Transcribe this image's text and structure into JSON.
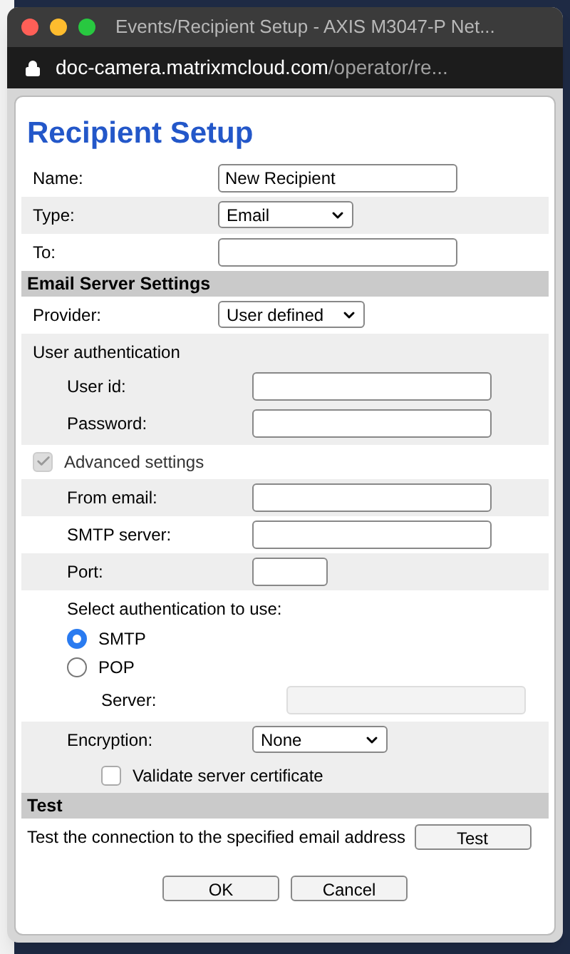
{
  "window": {
    "title": "Events/Recipient Setup - AXIS M3047-P Net..."
  },
  "address_bar": {
    "host": "doc-camera.matrixmcloud.com",
    "path": "/operator/re..."
  },
  "heading": "Recipient Setup",
  "sections": [
    {
      "rows": [
        {
          "kind": "field",
          "label": "Name:",
          "value": "New Recipient"
        },
        {
          "kind": "select",
          "label": "Type:",
          "value": "Email"
        },
        {
          "kind": "field",
          "label": "To:"
        }
      ]
    },
    {
      "title": "Email Server Settings",
      "rows": [
        {
          "kind": "select",
          "label": "Provider:",
          "value": "User defined"
        },
        {
          "kind": "group",
          "label": "User authentication",
          "children": [
            {
              "kind": "field",
              "label": "User id:"
            },
            {
              "kind": "field",
              "label": "Password:"
            }
          ]
        },
        {
          "kind": "subsection",
          "label": "Advanced settings",
          "checked": true,
          "disabled": true,
          "rows": [
            {
              "kind": "field",
              "label": "From email:"
            },
            {
              "kind": "field",
              "label": "SMTP server:"
            },
            {
              "kind": "short_field",
              "label": "Port:"
            },
            {
              "kind": "group",
              "label": "Select authentication to use:",
              "children": [
                {
                  "kind": "radio",
                  "label": "SMTP",
                  "selected": true
                },
                {
                  "kind": "radio",
                  "label": "POP",
                  "selected": false,
                  "children": [
                    {
                      "kind": "field",
                      "label": "Server:",
                      "disabled": true
                    }
                  ]
                }
              ]
            },
            {
              "kind": "select",
              "label": "Encryption:",
              "value": "None",
              "children": [
                {
                  "kind": "checkbox",
                  "label": "Validate server certificate",
                  "checked": false,
                  "disabled": false
                }
              ]
            }
          ]
        }
      ]
    },
    {
      "title": "Test",
      "rows": [
        {
          "kind": "action",
          "label": "Test the connection to the specified email address",
          "button": "Test"
        }
      ]
    }
  ],
  "buttons": [
    "OK",
    "Cancel"
  ]
}
